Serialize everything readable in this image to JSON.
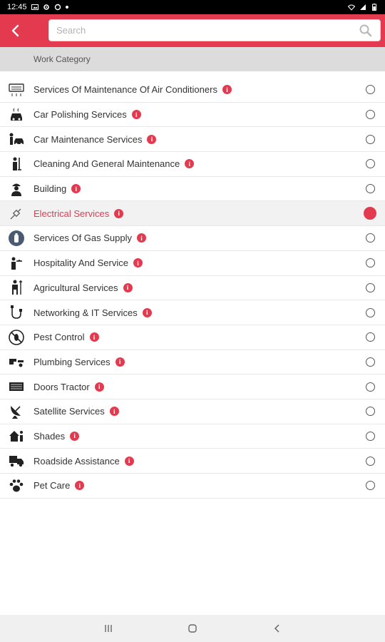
{
  "status_bar": {
    "time": "12:45",
    "icons_left": [
      "gallery-icon",
      "gear-icon",
      "sync-icon",
      "dot-icon"
    ],
    "icons_right": [
      "wifi-icon",
      "signal-icon",
      "battery-icon"
    ]
  },
  "header": {
    "back_icon": "chevron-left-icon",
    "search_placeholder": "Search",
    "search_value": "",
    "search_icon": "search-icon",
    "accent_color": "#e33a4f"
  },
  "section": {
    "title": "Work Category"
  },
  "items": [
    {
      "label": "Services Of Maintenance Of Air Conditioners",
      "icon": "air-conditioner-icon",
      "selected": false
    },
    {
      "label": "Car Polishing Services",
      "icon": "car-wash-icon",
      "selected": false
    },
    {
      "label": "Car Maintenance Services",
      "icon": "car-mechanic-icon",
      "selected": false
    },
    {
      "label": "Cleaning And General Maintenance",
      "icon": "cleaner-icon",
      "selected": false
    },
    {
      "label": "Building",
      "icon": "construction-worker-icon",
      "selected": false
    },
    {
      "label": "Electrical Services",
      "icon": "electrical-plug-icon",
      "selected": true
    },
    {
      "label": "Services Of Gas Supply",
      "icon": "gas-cylinder-icon",
      "selected": false
    },
    {
      "label": "Hospitality And Service",
      "icon": "waiter-icon",
      "selected": false
    },
    {
      "label": "Agricultural Services",
      "icon": "farmer-icon",
      "selected": false
    },
    {
      "label": "Networking & IT Services",
      "icon": "network-cable-icon",
      "selected": false
    },
    {
      "label": "Pest Control",
      "icon": "no-bugs-icon",
      "selected": false
    },
    {
      "label": "Plumbing Services",
      "icon": "plumber-icon",
      "selected": false
    },
    {
      "label": "Doors Tractor",
      "icon": "door-icon",
      "selected": false
    },
    {
      "label": "Satellite Services",
      "icon": "satellite-dish-icon",
      "selected": false
    },
    {
      "label": "Shades",
      "icon": "shade-icon",
      "selected": false
    },
    {
      "label": "Roadside Assistance",
      "icon": "tow-truck-icon",
      "selected": false
    },
    {
      "label": "Pet Care",
      "icon": "paw-icon",
      "selected": false
    }
  ],
  "info_glyph": "i",
  "nav_bar": {
    "recents_icon": "recents-icon",
    "home_icon": "home-icon",
    "back_icon": "back-icon"
  }
}
